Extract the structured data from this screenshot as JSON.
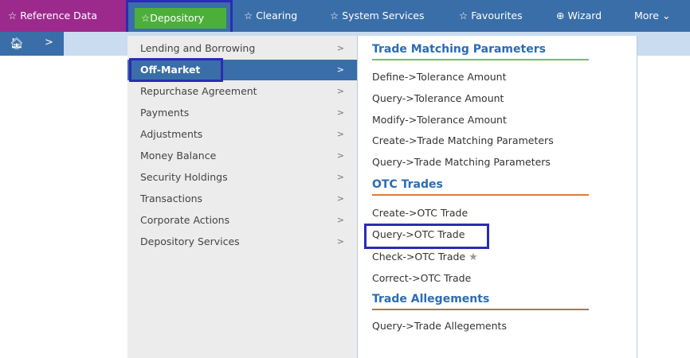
{
  "nav": {
    "reference_data": "Reference Data",
    "depository": "Depository",
    "clearing": "Clearing",
    "system_services": "System Services",
    "favourites": "Favourites",
    "wizard": "Wizard",
    "more": "More"
  },
  "breadcrumb": {
    "separator": ">"
  },
  "submenu": {
    "items": [
      {
        "label": "Lending and Borrowing"
      },
      {
        "label": "Off-Market"
      },
      {
        "label": "Repurchase Agreement"
      },
      {
        "label": "Payments"
      },
      {
        "label": "Adjustments"
      },
      {
        "label": "Money Balance"
      },
      {
        "label": "Security Holdings"
      },
      {
        "label": "Transactions"
      },
      {
        "label": "Corporate Actions"
      },
      {
        "label": "Depository Services"
      }
    ],
    "arrow": ">"
  },
  "flyout": {
    "trade_matching": {
      "title": "Trade Matching Parameters",
      "links": [
        "Define->Tolerance Amount",
        "Query->Tolerance Amount",
        "Modify->Tolerance Amount",
        "Create->Trade Matching Parameters",
        "Query->Trade Matching Parameters"
      ]
    },
    "otc_trades": {
      "title": "OTC Trades",
      "links": [
        "Create->OTC Trade",
        "Query->OTC Trade",
        "Check->OTC Trade",
        "Correct->OTC Trade"
      ]
    },
    "trade_allegements": {
      "title": "Trade Allegements",
      "links": [
        "Query->Trade Allegements"
      ]
    }
  },
  "colors": {
    "nav_bar": "#3a6ea8",
    "reference_tab": "#9c2a8c",
    "depository_tab": "#4caf3a",
    "highlight_border": "#2b2bb5",
    "section_title": "#2a6cb4"
  }
}
